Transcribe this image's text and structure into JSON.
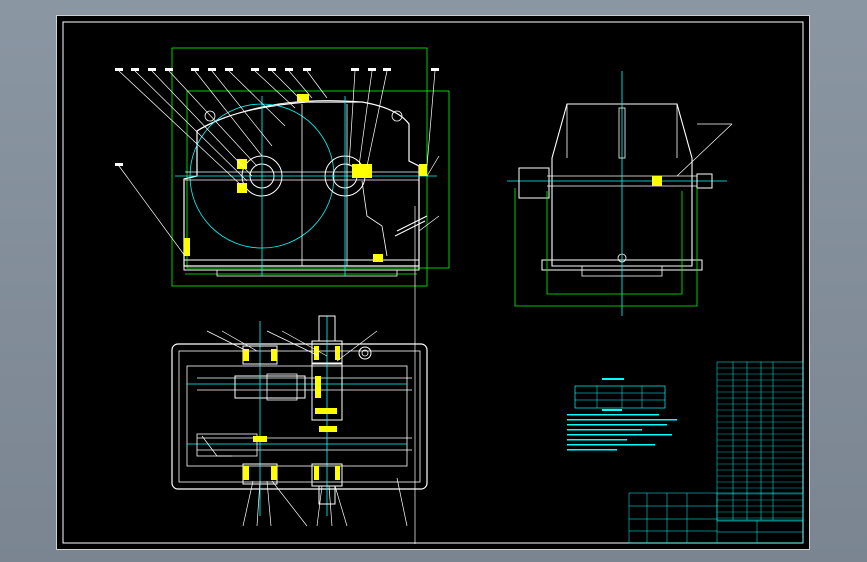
{
  "viewer": {
    "background": "#8b96a3",
    "sheet_background": "#000000",
    "frame_color": "#ffffff"
  },
  "colors": {
    "geometry": "#ffffff",
    "construction": "#00ff00",
    "center_lines": "#00ffff",
    "section_fill": "#ffff00",
    "leaders": "#ffffff",
    "text": "#00ffff"
  },
  "views": [
    {
      "id": "front",
      "name": "front-view"
    },
    {
      "id": "side",
      "name": "side-view"
    },
    {
      "id": "plan",
      "name": "plan-view"
    }
  ],
  "tables": {
    "parts_list": {
      "name": "parts-list"
    },
    "title_block": {
      "name": "title-block"
    },
    "spec_table": {
      "name": "technical-characteristics"
    },
    "notes": {
      "name": "technical-requirements"
    }
  }
}
